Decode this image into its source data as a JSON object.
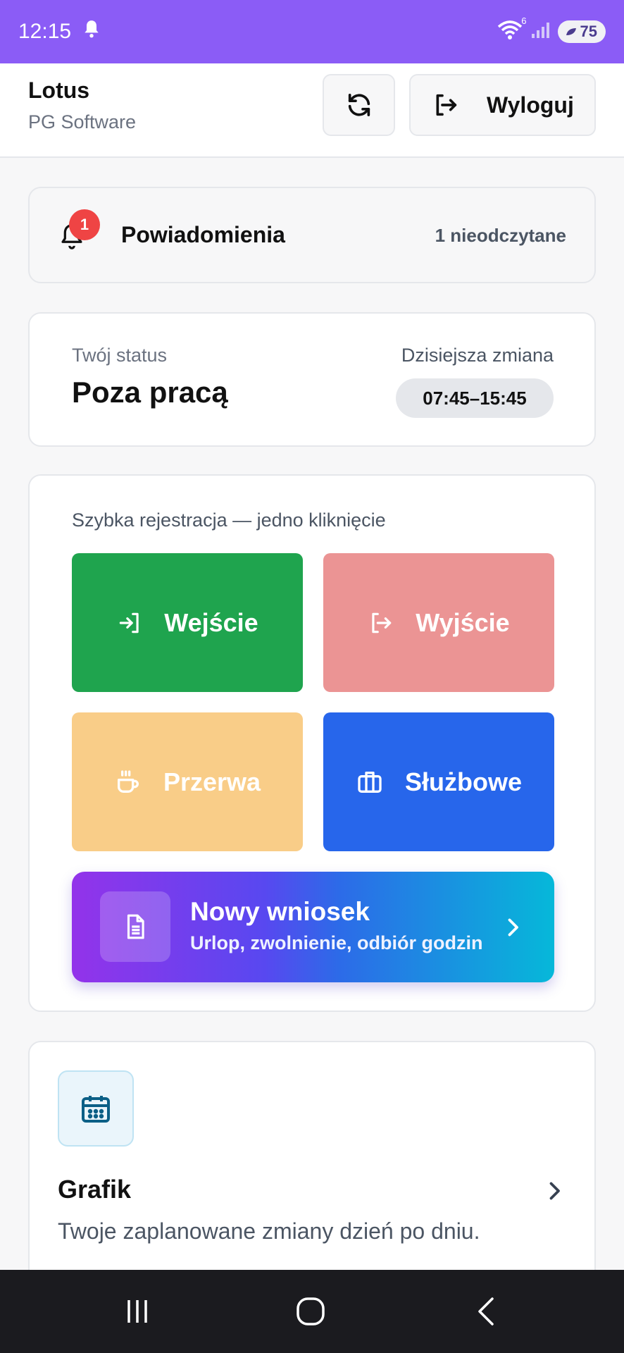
{
  "status_bar": {
    "time": "12:15",
    "battery": "75",
    "wifi_sub": "6"
  },
  "app_bar": {
    "title": "Lotus",
    "subtitle": "PG Software",
    "logout_label": "Wyloguj"
  },
  "notifications": {
    "title": "Powiadomienia",
    "badge": "1",
    "unread_text": "1 nieodczytane"
  },
  "status": {
    "label": "Twój status",
    "value": "Poza pracą",
    "shift_label": "Dzisiejsza zmiana",
    "shift_time": "07:45–15:45"
  },
  "quick": {
    "label": "Szybka rejestracja — jedno kliknięcie",
    "enter": "Wejście",
    "exit": "Wyjście",
    "break": "Przerwa",
    "business": "Służbowe"
  },
  "new_request": {
    "title": "Nowy wniosek",
    "subtitle": "Urlop, zwolnienie, odbiór godzin"
  },
  "schedule": {
    "title": "Grafik",
    "description": "Twoje zaplanowane zmiany dzień po dniu."
  },
  "colors": {
    "status_bar": "#8b5cf6",
    "enter": "#1fa44e",
    "exit": "#eb9494",
    "break": "#f9cd88",
    "business": "#2766eb",
    "badge": "#ef4444"
  }
}
